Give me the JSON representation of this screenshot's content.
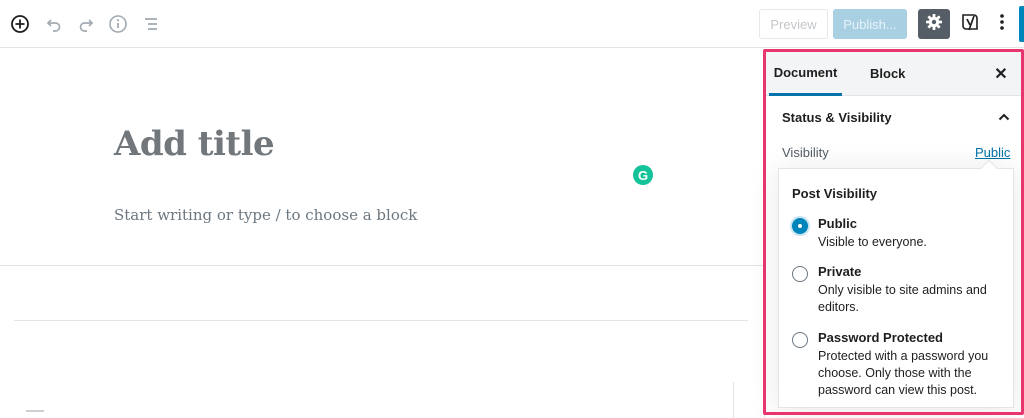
{
  "toolbar": {
    "icons": [
      "add-block-icon",
      "undo-icon",
      "redo-icon",
      "info-icon",
      "outline-icon",
      "gear-icon",
      "yoast-icon",
      "more-vertical-icon"
    ],
    "preview_label": "Preview",
    "publish_label": "Publish...",
    "colors": {
      "publish_bg": "#a9cfe3",
      "settings_bg": "#555d66",
      "accent": "#0085ba"
    }
  },
  "editor": {
    "title_placeholder": "Add title",
    "body_placeholder": "Start writing or type / to choose a block",
    "grammarly_glyph": "G"
  },
  "sidebar": {
    "tabs": [
      {
        "label": "Document",
        "active": true
      },
      {
        "label": "Block",
        "active": false
      }
    ],
    "close_glyph": "✕",
    "section_title": "Status & Visibility",
    "visibility_label": "Visibility",
    "visibility_value": "Public",
    "highlight_color": "#e8356d"
  },
  "popover": {
    "title": "Post Visibility",
    "options": [
      {
        "name": "Public",
        "desc": "Visible to everyone.",
        "selected": true
      },
      {
        "name": "Private",
        "desc": "Only visible to site admins and editors.",
        "selected": false
      },
      {
        "name": "Password Protected",
        "desc": "Protected with a password you choose. Only those with the password can view this post.",
        "selected": false
      }
    ]
  }
}
